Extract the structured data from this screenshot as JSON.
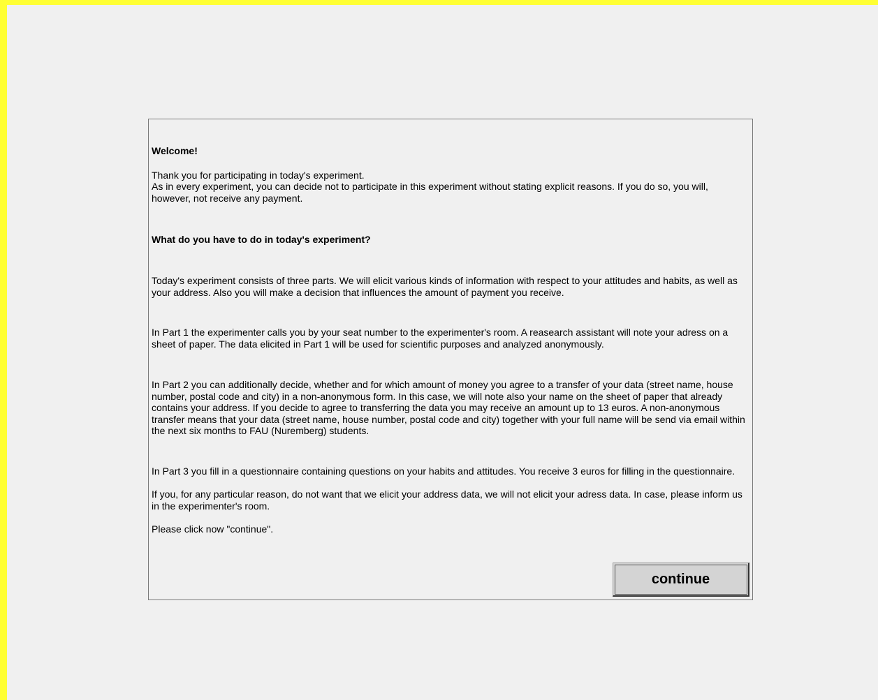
{
  "instructions": {
    "welcome_heading": "Welcome!",
    "thanks_line": "Thank you for participating in today's experiment.",
    "opt_out_text": "As in every experiment, you can decide not to participate in this experiment  without stating explicit reasons. If you do so, you will, however, not receive any payment.",
    "task_heading": "What do you have to do in today's experiment?",
    "overview_text": "Today's experiment consists of three parts. We will elicit various kinds of information with respect to your attitudes and habits, as well as your address. Also you will make a decision that influences the amount of payment you receive.",
    "part1_text": "In Part 1 the experimenter calls you by your seat number to the experimenter's room. A reasearch assistant will note your adress on a sheet of paper. The data elicited in Part 1 will be used for scientific purposes and analyzed anonymously.",
    "part2_text": "In Part 2 you can additionally decide, whether and for which amount of money you agree to a transfer of your data (street name, house number, postal code and city) in a non-anonymous form. In this case, we will note also your name on the sheet of paper that already contains your address. If you decide to agree to transferring the data you may receive an amount up to 13 euros. A non-anonymous transfer means that your data (street name, house number, postal code and city) together with your full name will be send via email within the next six months to FAU (Nuremberg) students.",
    "part3_text": "In Part 3 you fill in a questionnaire containing questions on your habits and attitudes. You receive 3 euros for filling in the questionnaire.",
    "decline_text": "If you, for any particular reason, do not want that we elicit your address data, we will not elicit your adress data. In case, please inform us in the experimenter's room.",
    "click_prompt": "Please click now \"continue\"."
  },
  "buttons": {
    "continue_label": "continue"
  },
  "colors": {
    "frame_border": "#ffff33",
    "background": "#f0f0f0",
    "button_face": "#d4d4d4"
  }
}
